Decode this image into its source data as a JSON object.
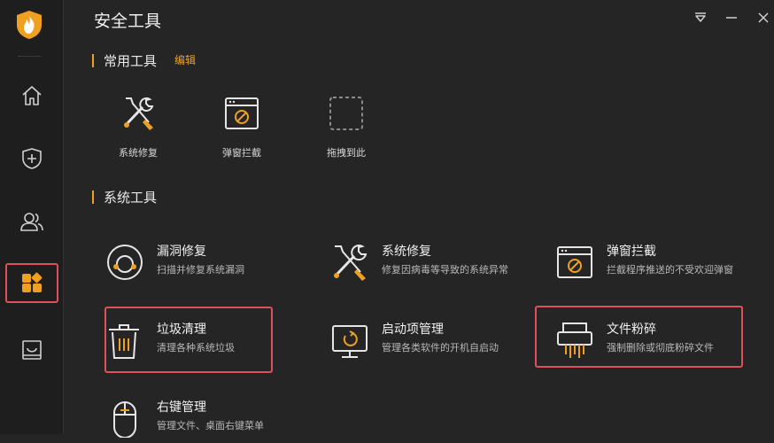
{
  "app": {
    "title": "安全工具"
  },
  "window_controls": [
    "menu-icon",
    "minimize-icon",
    "close-icon"
  ],
  "sidebar": {
    "items": [
      {
        "name": "home-icon",
        "active": false
      },
      {
        "name": "shield-plus-icon",
        "active": false
      },
      {
        "name": "users-icon",
        "active": false
      },
      {
        "name": "apps-icon",
        "active": true
      },
      {
        "name": "box-icon",
        "active": false
      }
    ]
  },
  "common_tools": {
    "heading": "常用工具",
    "edit_label": "编辑",
    "items": [
      {
        "label": "系统修复",
        "icon": "wrench-screwdriver-icon"
      },
      {
        "label": "弹窗拦截",
        "icon": "popup-block-icon"
      },
      {
        "label": "拖拽到此",
        "icon": "drop-target-icon"
      }
    ]
  },
  "system_tools": {
    "heading": "系统工具",
    "items": [
      {
        "name": "漏洞修复",
        "desc": "扫描并修复系统漏洞",
        "icon": "patch-icon"
      },
      {
        "name": "系统修复",
        "desc": "修复因病毒等导致的系统异常",
        "icon": "wrench-screwdriver-icon"
      },
      {
        "name": "弹窗拦截",
        "desc": "拦截程序推送的不受欢迎弹窗",
        "icon": "popup-block-icon"
      },
      {
        "name": "垃圾清理",
        "desc": "清理各种系统垃圾",
        "icon": "trash-icon"
      },
      {
        "name": "启动项管理",
        "desc": "管理各类软件的开机自启动",
        "icon": "monitor-startup-icon"
      },
      {
        "name": "文件粉碎",
        "desc": "强制删除或彻底粉碎文件",
        "icon": "shredder-icon"
      },
      {
        "name": "右键管理",
        "desc": "管理文件、桌面右键菜单",
        "icon": "mouse-icon"
      }
    ]
  },
  "colors": {
    "accent": "#f0a020",
    "highlight": "#e0505a",
    "background": "#252525",
    "sidebar": "#1e1e1e"
  }
}
